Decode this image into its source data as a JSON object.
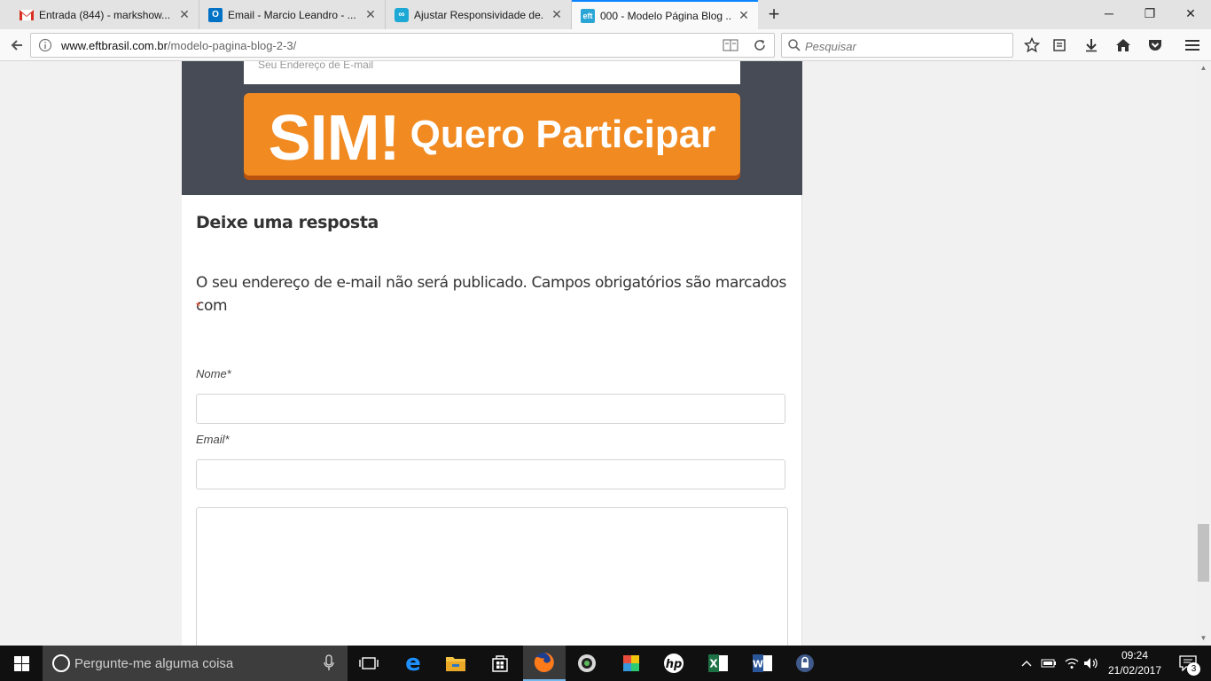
{
  "browser": {
    "tabs": [
      {
        "label": "Entrada (844) - markshow...",
        "favicon": "gmail-icon",
        "favicon_color": "#d93025",
        "active": false
      },
      {
        "label": "Email - Marcio Leandro - ...",
        "favicon": "outlook-icon",
        "favicon_color": "#0072c6",
        "active": false
      },
      {
        "label": "Ajustar Responsividade de...",
        "favicon": "chat-icon",
        "favicon_color": "#1ea8d6",
        "active": false
      },
      {
        "label": "000 - Modelo Página Blog ...",
        "favicon": "eft-icon",
        "favicon_color": "#2aa6d6",
        "active": true
      }
    ],
    "url_host": "www.eftbrasil.com.br",
    "url_path": "/modelo-pagina-blog-2-3/",
    "search_placeholder": "Pesquisar"
  },
  "page": {
    "optin_email_placeholder": "Seu Endereço de E-mail",
    "cta_big": "SIM!",
    "cta_small": "Quero Participar",
    "reply_title": "Deixe uma resposta",
    "comment_notes": "O seu endereço de e-mail não será publicado. Campos obrigatórios são marcados com",
    "required_mark": "*",
    "name_label": "Nome*",
    "email_label": "Email*",
    "colors": {
      "cta": "#f18a21",
      "optin_bg": "#474b55",
      "required": "#e8522e"
    }
  },
  "taskbar": {
    "search_placeholder": "Pergunte-me alguma coisa",
    "time": "09:24",
    "date": "21/02/2017",
    "notification_count": "3",
    "apps": [
      "task-view-icon",
      "edge-icon",
      "file-explorer-icon",
      "store-icon",
      "firefox-icon",
      "camera-icon",
      "paint-icon",
      "hp-icon",
      "excel-icon",
      "word-icon",
      "vpn-icon"
    ]
  }
}
